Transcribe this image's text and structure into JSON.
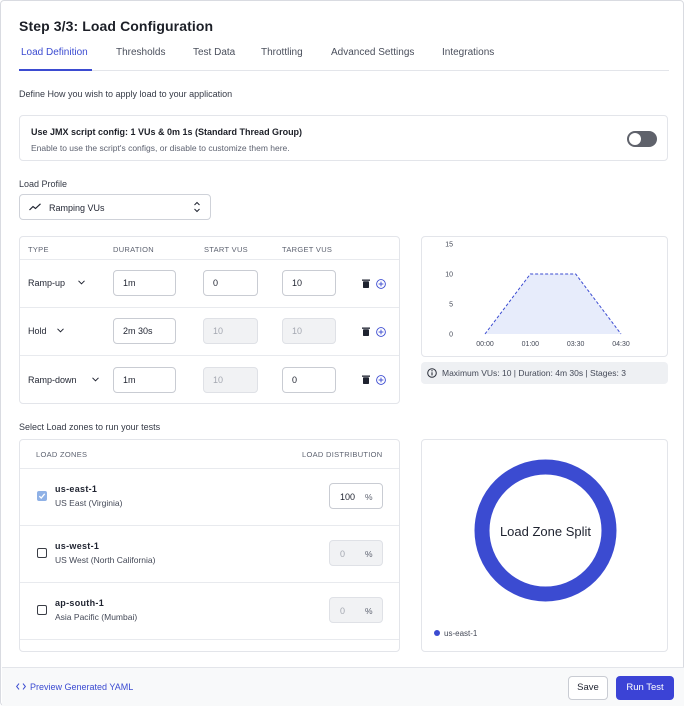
{
  "page": {
    "title": "Step 3/3: Load Configuration",
    "tabs": [
      {
        "label": "Load Definition",
        "active": true
      },
      {
        "label": "Thresholds"
      },
      {
        "label": "Test Data"
      },
      {
        "label": "Throttling"
      },
      {
        "label": "Advanced Settings"
      },
      {
        "label": "Integrations"
      }
    ],
    "description": "Define How you wish to apply load to your application"
  },
  "jmx": {
    "title": "Use JMX script config: 1 VUs & 0m 1s (Standard Thread Group)",
    "subtitle": "Enable to use the script's configs, or disable to customize them here.",
    "enabled": false
  },
  "load_profile": {
    "label": "Load Profile",
    "selected": "Ramping VUs"
  },
  "stages_table": {
    "headers": {
      "type": "TYPE",
      "duration": "DURATION",
      "start": "START VUS",
      "target": "TARGET VUS"
    },
    "rows": [
      {
        "type": "Ramp-up",
        "duration": "1m",
        "start": "0",
        "target": "10",
        "start_disabled": false,
        "target_disabled": false
      },
      {
        "type": "Hold",
        "duration": "2m 30s",
        "start": "10",
        "target": "10",
        "start_disabled": true,
        "target_disabled": true
      },
      {
        "type": "Ramp-down",
        "duration": "1m",
        "start": "10",
        "target": "0",
        "start_disabled": true,
        "target_disabled": false
      }
    ]
  },
  "chart_data": {
    "type": "area",
    "title": "",
    "xlabel": "",
    "ylabel": "",
    "x": [
      "00:00",
      "01:00",
      "03:30",
      "04:30"
    ],
    "series": [
      {
        "values": [
          0,
          10,
          10,
          0
        ]
      }
    ],
    "y_ticks": [
      0,
      5,
      10,
      15
    ],
    "ylim": [
      0,
      15
    ],
    "grid": false,
    "line_color": "#3b4bd1",
    "fill_color": "#e7ecfb"
  },
  "summary": "Maximum VUs: 10 | Duration: 4m 30s | Stages: 3",
  "zones": {
    "section_label": "Select Load zones to run your tests",
    "headers": {
      "zones": "LOAD ZONES",
      "distribution": "LOAD DISTRIBUTION"
    },
    "items": [
      {
        "code": "us-east-1",
        "name": "US East (Virginia)",
        "checked": true,
        "pct": "100",
        "unit": "%"
      },
      {
        "code": "us-west-1",
        "name": "US West (North California)",
        "checked": false,
        "pct": "0",
        "unit": "%"
      },
      {
        "code": "ap-south-1",
        "name": "Asia Pacific (Mumbai)",
        "checked": false,
        "pct": "0",
        "unit": "%"
      }
    ]
  },
  "donut": {
    "center_label": "Load Zone Split",
    "legend": "us-east-1",
    "values": [
      100
    ],
    "color": "#3b4bd1"
  },
  "footer": {
    "preview_label": "Preview Generated YAML",
    "save_label": "Save",
    "run_label": "Run Test"
  }
}
